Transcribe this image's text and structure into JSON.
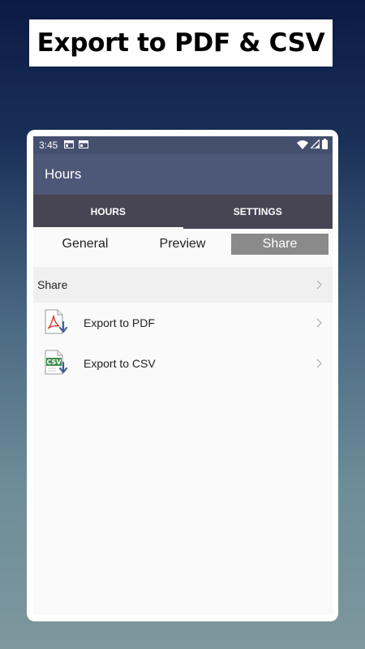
{
  "banner": {
    "title": "Export to PDF & CSV"
  },
  "status_bar": {
    "time": "3:45",
    "icons": [
      "calendar-icon",
      "calendar-icon",
      "wifi-icon",
      "signal-icon",
      "battery-icon"
    ]
  },
  "app_bar": {
    "title": "Hours"
  },
  "tabs": [
    {
      "label": "HOURS",
      "active": true
    },
    {
      "label": "SETTINGS",
      "active": false
    }
  ],
  "segments": [
    {
      "label": "General",
      "selected": false
    },
    {
      "label": "Preview",
      "selected": false
    },
    {
      "label": "Share",
      "selected": true
    }
  ],
  "share_section": {
    "header": "Share",
    "items": [
      {
        "label": "Export to PDF",
        "icon": "pdf-file-icon"
      },
      {
        "label": "Export to CSV",
        "icon": "csv-file-icon",
        "icon_text": "CSV"
      }
    ]
  },
  "colors": {
    "status_bar": "#45506f",
    "app_bar": "#4d5777",
    "tab_bar": "#474553",
    "segment_selected": "#8a8a8a",
    "pdf_accent": "#d9342b",
    "csv_accent": "#3f8f4f"
  }
}
